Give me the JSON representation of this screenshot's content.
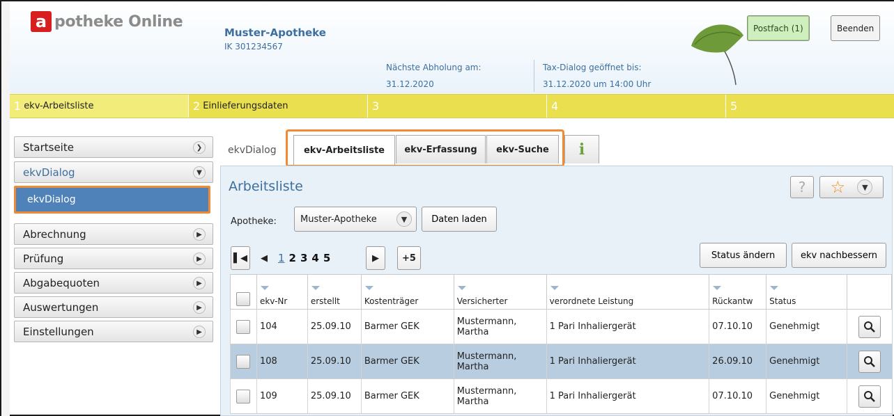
{
  "header": {
    "logo_letter": "a",
    "logo_text": "potheke Online",
    "pharmacy_name": "Muster-Apotheke",
    "pharmacy_ik": "IK 301234567",
    "pickup_label": "Nächste Abholung am:",
    "pickup_date": "31.12.2020",
    "tax_label": "Tax-Dialog geöffnet bis:",
    "tax_date": "31.12.2020 um 14:00 Uhr",
    "postfach_label": "Postfach (1)",
    "beenden_label": "Beenden"
  },
  "steps": [
    {
      "num": "1",
      "label": "ekv-Arbeitsliste"
    },
    {
      "num": "2",
      "label": "Einlieferungsdaten"
    },
    {
      "num": "3",
      "label": ""
    },
    {
      "num": "4",
      "label": ""
    },
    {
      "num": "5",
      "label": ""
    }
  ],
  "sidebar": {
    "startseite": "Startseite",
    "ekvdialog": "ekvDialog",
    "ekvdialog_sub": "ekvDialog",
    "abrechnung": "Abrechnung",
    "pruefung": "Prüfung",
    "abgabequoten": "Abgabequoten",
    "auswertungen": "Auswertungen",
    "einstellungen": "Einstellungen"
  },
  "tabs": {
    "breadcrumb": "ekvDialog",
    "arbeitsliste": "ekv-Arbeitsliste",
    "erfassung": "ekv-Erfassung",
    "suche": "ekv-Suche",
    "info": "i"
  },
  "panel": {
    "title": "Arbeitsliste",
    "help": "?",
    "apotheke_label": "Apotheke:",
    "apotheke_value": "Muster-Apotheke",
    "daten_laden": "Daten laden",
    "plus5": "+5",
    "status_aendern": "Status ändern",
    "ekv_nachbessern": "ekv nachbessern"
  },
  "pages": [
    "1",
    "2",
    "3",
    "4",
    "5"
  ],
  "table": {
    "headers": [
      "ekv-Nr",
      "erstellt",
      "Kostenträger",
      "Versicherter",
      "verordnete Leistung",
      "Rückantw",
      "Status"
    ],
    "rows": [
      {
        "nr": "104",
        "erstellt": "25.09.10",
        "kostentraeger": "Barmer GEK",
        "versicherter": "Mustermann, Martha",
        "leistung": "1 Pari Inhaliergerät",
        "rueckantw": "07.10.10",
        "status": "Genehmigt"
      },
      {
        "nr": "108",
        "erstellt": "25.09.10",
        "kostentraeger": "Barmer GEK",
        "versicherter": "Mustermann, Martha",
        "leistung": "1 Pari Inhaliergerät",
        "rueckantw": "26.09.10",
        "status": "Genehmigt"
      },
      {
        "nr": "109",
        "erstellt": "25.09.10",
        "kostentraeger": "Barmer GEK",
        "versicherter": "Mustermann, Martha",
        "leistung": "1 Pari Inhaliergerät",
        "rueckantw": "07.10.10",
        "status": "Genehmigt"
      }
    ]
  },
  "colors": {
    "accent_blue": "#3d6f9f",
    "highlight_orange": "#f08a33",
    "step_yellow": "#f2ec7a",
    "selected_row": "#b9cde0",
    "logo_red": "#d81f1f"
  },
  "icons": {
    "first_page": "first-page-icon",
    "prev_page": "prev-page-icon",
    "next_page": "next-page-icon",
    "search_row": "magnifier-icon",
    "favorite": "star-icon",
    "help": "help-icon",
    "info": "info-icon"
  }
}
